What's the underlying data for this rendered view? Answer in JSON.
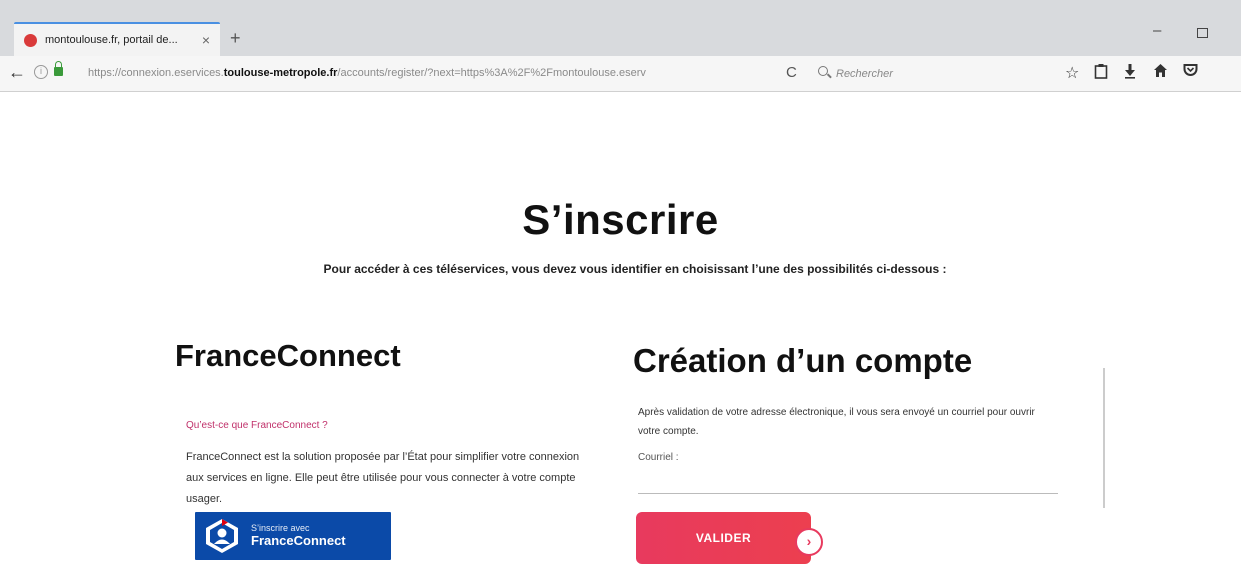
{
  "browser": {
    "tab_title": "montoulouse.fr, portail de...",
    "tab_close": "×",
    "new_tab": "+",
    "url_prefix": "https://connexion.eservices.",
    "url_domain": "toulouse-metropole.fr",
    "url_path": "/accounts/register/?next=https%3A%2F%2Fmontoulouse.eserv",
    "search_placeholder": "Rechercher",
    "minimize": "–",
    "back": "←",
    "reload": "C",
    "info": "i"
  },
  "page": {
    "title": "S’inscrire",
    "intro": "Pour accéder à ces téléservices, vous devez vous identifier en choisissant l’une des possibilités ci-dessous :"
  },
  "franceconnect": {
    "title": "FranceConnect",
    "link": "Qu’est-ce que FranceConnect ?",
    "description": "FranceConnect est la solution proposée par l’État pour simplifier votre connexion aux services en ligne. Elle peut être utilisée pour vous connecter à votre compte usager.",
    "button_small": "S’inscrire avec",
    "button_big": "FranceConnect"
  },
  "account": {
    "title": "Création d’un compte",
    "description": "Après validation de votre adresse électronique, il vous sera envoyé un courriel pour ouvrir votre compte.",
    "email_label": "Courriel :",
    "email_value": "",
    "submit_label": "VALIDER",
    "submit_arrow": "›"
  },
  "colors": {
    "accent": "#e83a5e",
    "franceconnect_blue": "#0b4aa8",
    "link_pink": "#c0306a"
  },
  "icons": [
    "favicon-icon",
    "back-arrow-icon",
    "info-icon",
    "lock-icon",
    "reload-icon",
    "search-icon",
    "star-icon",
    "clipboard-icon",
    "download-icon",
    "home-icon",
    "pocket-icon",
    "franceconnect-logo-icon",
    "arrow-right-icon"
  ]
}
